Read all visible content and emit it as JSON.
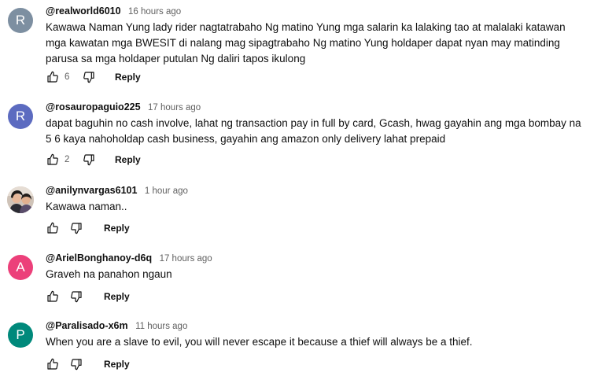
{
  "comments": [
    {
      "handle": "@realworld6010",
      "time": "16 hours ago",
      "avatar_letter": "R",
      "avatar_color": "#7d8fa1",
      "text": "Kawawa Naman Yung lady rider nagtatrabaho Ng matino Yung mga salarin ka lalaking tao at malalaki katawan mga kawatan mga BWESIT di nalang mag sipagtrabaho Ng matino Yung holdaper dapat nyan may matinding parusa sa mga holdaper putulan Ng daliri tapos ikulong",
      "likes": "6",
      "reply_label": "Reply"
    },
    {
      "handle": "@rosauropaguio225",
      "time": "17 hours ago",
      "avatar_letter": "R",
      "avatar_color": "#5c6bc0",
      "text": "dapat baguhin  no cash involve, lahat ng transaction pay in full by card, Gcash, hwag gayahin ang mga bombay na 5 6 kaya nahoholdap cash business, gayahin ang amazon only delivery lahat prepaid",
      "likes": "2",
      "reply_label": "Reply"
    },
    {
      "handle": "@anilynvargas6101",
      "time": "1 hour ago",
      "avatar_letter": "",
      "avatar_color": "",
      "text": "Kawawa naman..",
      "likes": "",
      "reply_label": "Reply"
    },
    {
      "handle": "@ArielBonghanoy-d6q",
      "time": "17 hours ago",
      "avatar_letter": "A",
      "avatar_color": "#ec407a",
      "text": "Graveh na panahon ngaun",
      "likes": "",
      "reply_label": "Reply"
    },
    {
      "handle": "@Paralisado-x6m",
      "time": "11 hours ago",
      "avatar_letter": "P",
      "avatar_color": "#00897b",
      "text": "When you are a slave to evil, you will never escape it because a thief will always be a thief.",
      "likes": "",
      "reply_label": "Reply"
    }
  ],
  "icons": {
    "like": "thumb-up-outline",
    "dislike": "thumb-down-outline"
  }
}
